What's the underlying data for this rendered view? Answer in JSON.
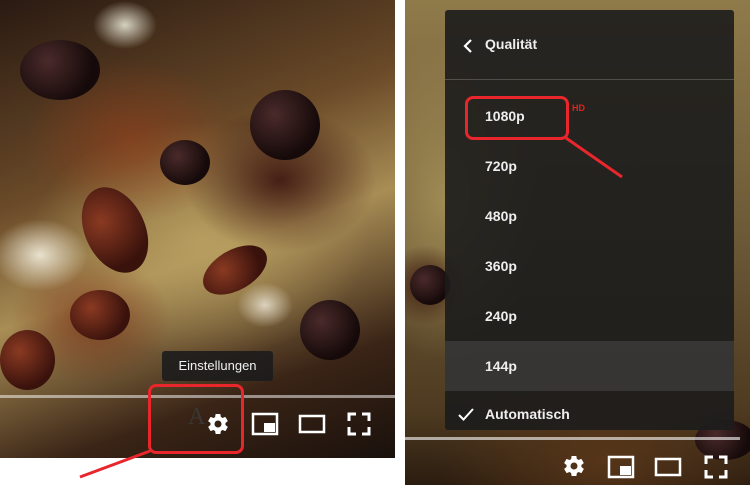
{
  "left_player": {
    "tooltip": "Einstellungen",
    "controls": [
      "settings-gear",
      "miniplayer",
      "theater-mode",
      "fullscreen"
    ],
    "partial_caption_text": "A"
  },
  "right_player": {
    "quality_menu": {
      "title": "Qualität",
      "options": [
        {
          "label": "1080p",
          "badge": "HD"
        },
        {
          "label": "720p"
        },
        {
          "label": "480p"
        },
        {
          "label": "360p"
        },
        {
          "label": "240p"
        },
        {
          "label": "144p"
        }
      ],
      "selected_option": "144p",
      "checked_option": "Automatisch"
    },
    "controls": [
      "settings-gear",
      "miniplayer",
      "theater-mode",
      "fullscreen"
    ]
  },
  "colors": {
    "annotation_red": "#e8262c",
    "hd_badge_red": "#e62117",
    "menu_background": "#1c1c1c",
    "menu_text": "#eeeeee"
  }
}
